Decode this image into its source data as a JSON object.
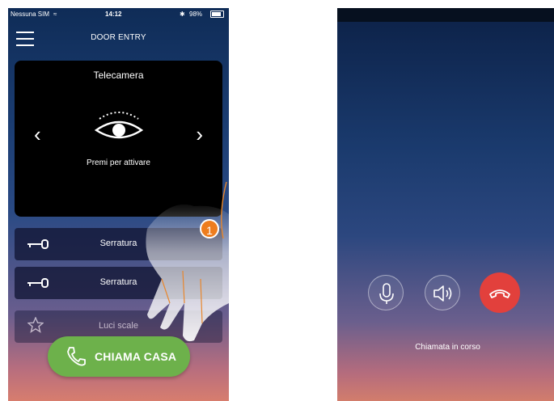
{
  "left_screen": {
    "status_bar": {
      "carrier": "Nessuna SIM",
      "time": "14:12",
      "battery": "98%",
      "battery_level": 0.98
    },
    "header_title": "DOOR ENTRY",
    "camera": {
      "title": "Telecamera",
      "hint": "Premi per attivare"
    },
    "items": [
      {
        "label": "Serratura",
        "icon": "key-icon"
      },
      {
        "label": "Serratura",
        "icon": "key-icon"
      },
      {
        "label": "Luci scale",
        "icon": "star-icon"
      }
    ],
    "step_badge": "1",
    "call_button_label": "CHIAMA CASA"
  },
  "right_screen": {
    "call_status": "Chiamata in corso",
    "controls": [
      "microphone-icon",
      "speaker-icon",
      "hang-up-icon"
    ],
    "hangup_color": "#e2403c"
  },
  "colors": {
    "accent_green": "#6db14b",
    "badge_orange": "#ee7d1e",
    "camera_bg": "#000000"
  }
}
